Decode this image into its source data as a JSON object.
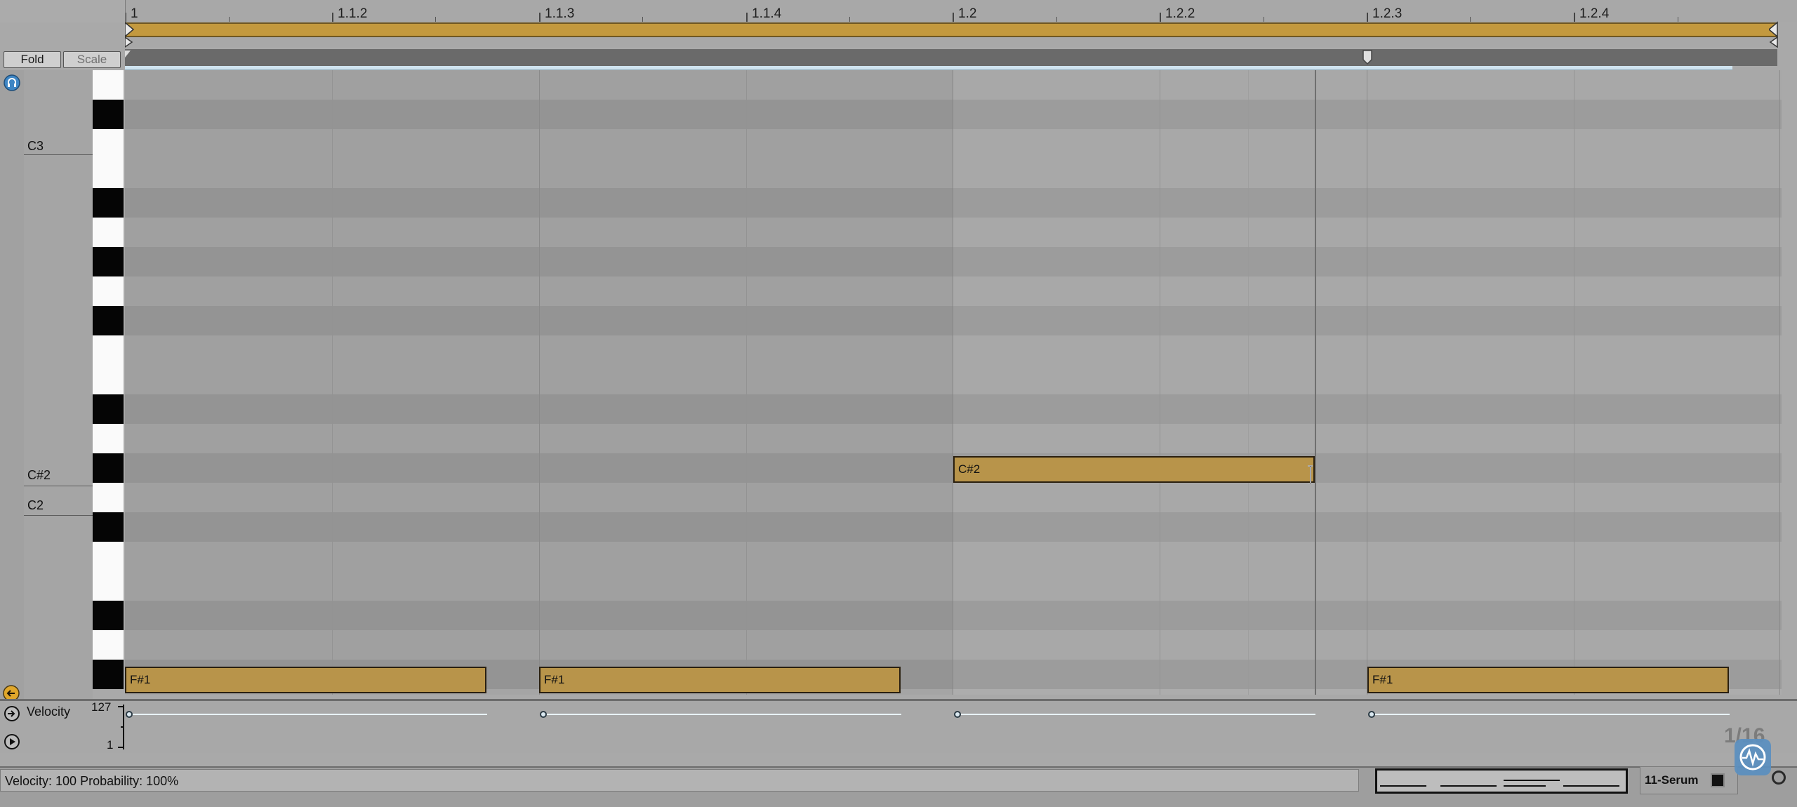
{
  "ruler": {
    "labels": [
      "1",
      "1.1.2",
      "1.1.3",
      "1.1.4",
      "1.2",
      "1.2.2",
      "1.2.3",
      "1.2.4"
    ]
  },
  "toolbar": {
    "fold_label": "Fold",
    "scale_label": "Scale"
  },
  "keyboard": {
    "octave_labels": [
      "C3",
      "C#2",
      "C2"
    ]
  },
  "notes": [
    {
      "pitch": "F#1",
      "start": "1",
      "end": "1.1.2.3"
    },
    {
      "pitch": "F#1",
      "start": "1.1.3",
      "end": "1.1.4.3"
    },
    {
      "pitch": "C#2",
      "start": "1.2",
      "end": "1.2.2.3"
    },
    {
      "pitch": "F#1",
      "start": "1.2.3",
      "end": "1.2.4.3"
    }
  ],
  "velocity_lane": {
    "title": "Velocity",
    "max": "127",
    "min": "1"
  },
  "grid_label": "1/16",
  "status": {
    "text": "Velocity: 100   Probability: 100%"
  },
  "device": {
    "label": "11-Serum"
  },
  "colors": {
    "note_fill": "#b8944a",
    "loop_brace": "#c3993e",
    "selection": "#cfe3ef",
    "accent_blue": "#3f86c4"
  }
}
